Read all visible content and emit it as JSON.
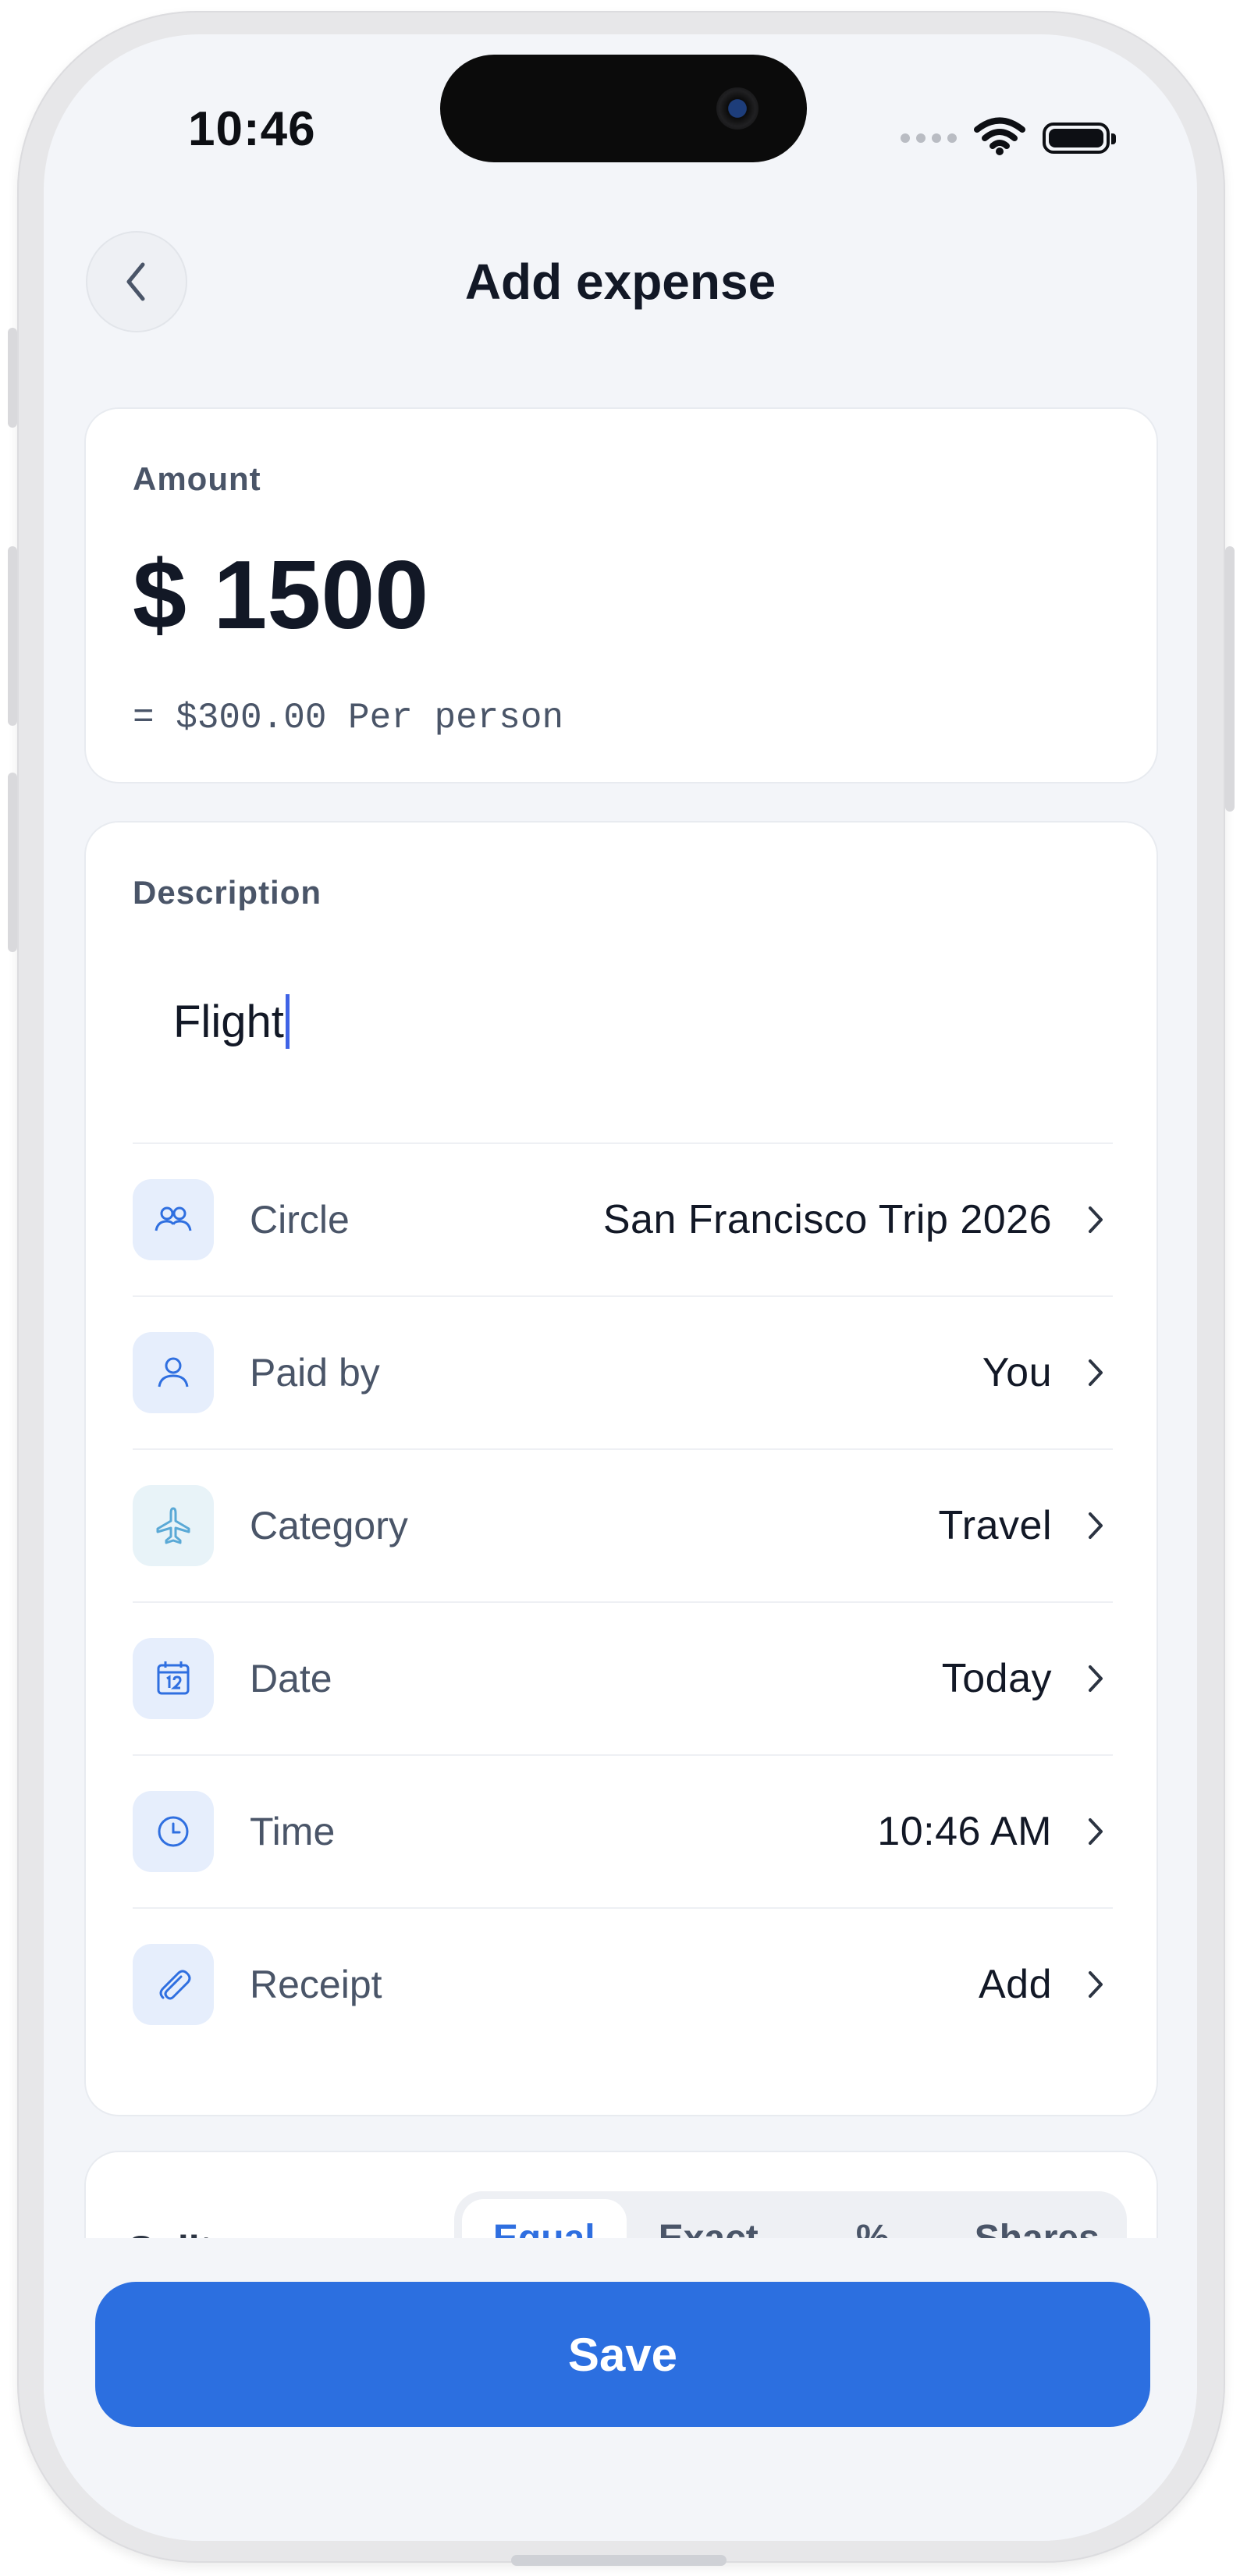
{
  "status_bar": {
    "time": "10:46"
  },
  "header": {
    "title": "Add expense"
  },
  "amount": {
    "label": "Amount",
    "value": "$ 1500",
    "per_person": "= $300.00 Per person"
  },
  "description": {
    "label": "Description",
    "value": "Flight"
  },
  "rows": [
    {
      "label": "Circle",
      "value": "San Francisco Trip 2026",
      "icon": "people-icon"
    },
    {
      "label": "Paid by",
      "value": "You",
      "icon": "person-icon"
    },
    {
      "label": "Category",
      "value": "Travel",
      "icon": "airplane-icon"
    },
    {
      "label": "Date",
      "value": "Today",
      "icon": "calendar-icon"
    },
    {
      "label": "Time",
      "value": "10:46 AM",
      "icon": "clock-icon"
    },
    {
      "label": "Receipt",
      "value": "Add",
      "icon": "paperclip-icon"
    }
  ],
  "split": {
    "label": "Split",
    "options": [
      "Equal",
      "Exact",
      "%",
      "Shares"
    ],
    "selected": "Equal"
  },
  "save_label": "Save",
  "colors": {
    "accent": "#2c6fe0",
    "background": "#f3f5f9",
    "card": "#ffffff"
  }
}
